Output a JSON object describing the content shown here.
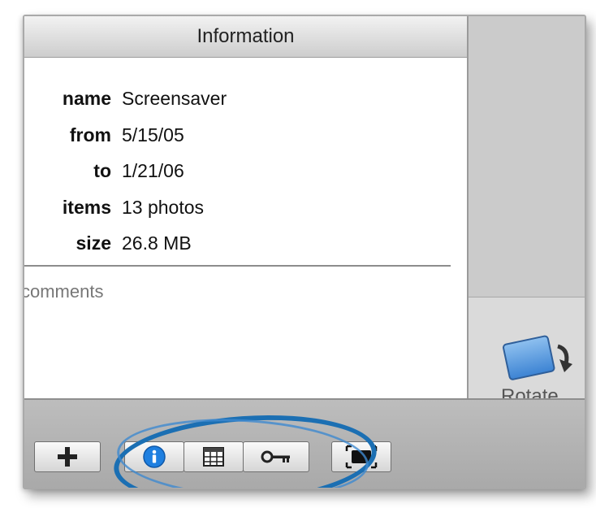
{
  "info": {
    "title": "Information",
    "rows": [
      {
        "label": "name",
        "value": "Screensaver"
      },
      {
        "label": "from",
        "value": "5/15/05"
      },
      {
        "label": "to",
        "value": "1/21/06"
      },
      {
        "label": "items",
        "value": "13 photos"
      },
      {
        "label": "size",
        "value": "26.8 MB"
      }
    ],
    "comments_placeholder": "comments"
  },
  "rotate": {
    "label": "Rotate"
  },
  "toolbar": {
    "buttons": [
      {
        "name": "add-button",
        "icon": "plus-icon"
      },
      {
        "name": "info-button",
        "icon": "info-icon"
      },
      {
        "name": "calendar-button",
        "icon": "calendar-icon"
      },
      {
        "name": "keyword-button",
        "icon": "key-icon"
      },
      {
        "name": "fullscreen-button",
        "icon": "fullscreen-icon"
      }
    ]
  },
  "colors": {
    "annotation": "#1b6fb3",
    "info_icon": "#1e7fe0"
  }
}
